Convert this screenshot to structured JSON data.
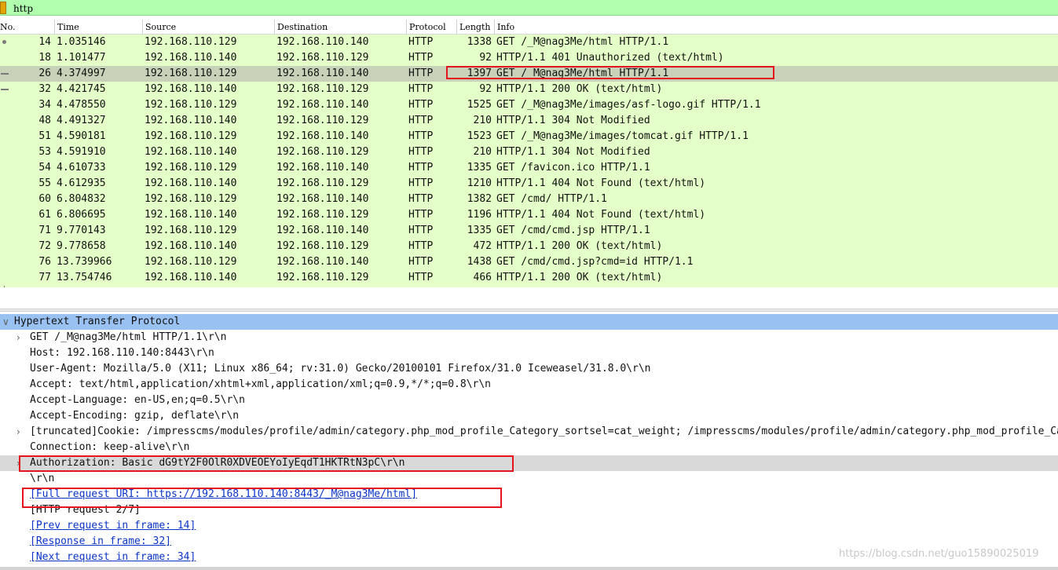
{
  "filter": {
    "text": "http",
    "bg_color": "#afffaf"
  },
  "columns": [
    "No.",
    "Time",
    "Source",
    "Destination",
    "Protocol",
    "Length",
    "Info"
  ],
  "packets": [
    {
      "no": "14",
      "time": "1.035146",
      "src": "192.168.110.129",
      "dst": "192.168.110.140",
      "proto": "HTTP",
      "len": "1338",
      "info": "GET /_M@nag3Me/html HTTP/1.1"
    },
    {
      "no": "18",
      "time": "1.101477",
      "src": "192.168.110.140",
      "dst": "192.168.110.129",
      "proto": "HTTP",
      "len": "92",
      "info": "HTTP/1.1 401 Unauthorized  (text/html)"
    },
    {
      "no": "26",
      "time": "4.374997",
      "src": "192.168.110.129",
      "dst": "192.168.110.140",
      "proto": "HTTP",
      "len": "1397",
      "info": "GET /_M@nag3Me/html HTTP/1.1",
      "selected": true
    },
    {
      "no": "32",
      "time": "4.421745",
      "src": "192.168.110.140",
      "dst": "192.168.110.129",
      "proto": "HTTP",
      "len": "92",
      "info": "HTTP/1.1 200 OK  (text/html)"
    },
    {
      "no": "34",
      "time": "4.478550",
      "src": "192.168.110.129",
      "dst": "192.168.110.140",
      "proto": "HTTP",
      "len": "1525",
      "info": "GET /_M@nag3Me/images/asf-logo.gif HTTP/1.1"
    },
    {
      "no": "48",
      "time": "4.491327",
      "src": "192.168.110.140",
      "dst": "192.168.110.129",
      "proto": "HTTP",
      "len": "210",
      "info": "HTTP/1.1 304 Not Modified"
    },
    {
      "no": "51",
      "time": "4.590181",
      "src": "192.168.110.129",
      "dst": "192.168.110.140",
      "proto": "HTTP",
      "len": "1523",
      "info": "GET /_M@nag3Me/images/tomcat.gif HTTP/1.1"
    },
    {
      "no": "53",
      "time": "4.591910",
      "src": "192.168.110.140",
      "dst": "192.168.110.129",
      "proto": "HTTP",
      "len": "210",
      "info": "HTTP/1.1 304 Not Modified"
    },
    {
      "no": "54",
      "time": "4.610733",
      "src": "192.168.110.129",
      "dst": "192.168.110.140",
      "proto": "HTTP",
      "len": "1335",
      "info": "GET /favicon.ico HTTP/1.1"
    },
    {
      "no": "55",
      "time": "4.612935",
      "src": "192.168.110.140",
      "dst": "192.168.110.129",
      "proto": "HTTP",
      "len": "1210",
      "info": "HTTP/1.1 404 Not Found  (text/html)"
    },
    {
      "no": "60",
      "time": "6.804832",
      "src": "192.168.110.129",
      "dst": "192.168.110.140",
      "proto": "HTTP",
      "len": "1382",
      "info": "GET /cmd/ HTTP/1.1"
    },
    {
      "no": "61",
      "time": "6.806695",
      "src": "192.168.110.140",
      "dst": "192.168.110.129",
      "proto": "HTTP",
      "len": "1196",
      "info": "HTTP/1.1 404 Not Found  (text/html)"
    },
    {
      "no": "71",
      "time": "9.770143",
      "src": "192.168.110.129",
      "dst": "192.168.110.140",
      "proto": "HTTP",
      "len": "1335",
      "info": "GET /cmd/cmd.jsp HTTP/1.1"
    },
    {
      "no": "72",
      "time": "9.778658",
      "src": "192.168.110.140",
      "dst": "192.168.110.129",
      "proto": "HTTP",
      "len": "472",
      "info": "HTTP/1.1 200 OK  (text/html)"
    },
    {
      "no": "76",
      "time": "13.739966",
      "src": "192.168.110.129",
      "dst": "192.168.110.140",
      "proto": "HTTP",
      "len": "1438",
      "info": "GET /cmd/cmd.jsp?cmd=id HTTP/1.1"
    },
    {
      "no": "77",
      "time": "13.754746",
      "src": "192.168.110.140",
      "dst": "192.168.110.129",
      "proto": "HTTP",
      "len": "466",
      "info": "HTTP/1.1 200 OK  (text/html)"
    }
  ],
  "details": {
    "protocol": "Hypertext Transfer Protocol",
    "lines": [
      {
        "text": "GET /_M@nag3Me/html HTTP/1.1\\r\\n",
        "expandable": true
      },
      {
        "text": "Host: 192.168.110.140:8443\\r\\n"
      },
      {
        "text": "User-Agent: Mozilla/5.0 (X11; Linux x86_64; rv:31.0) Gecko/20100101 Firefox/31.0 Iceweasel/31.8.0\\r\\n"
      },
      {
        "text": "Accept: text/html,application/xhtml+xml,application/xml;q=0.9,*/*;q=0.8\\r\\n"
      },
      {
        "text": "Accept-Language: en-US,en;q=0.5\\r\\n"
      },
      {
        "text": "Accept-Encoding: gzip, deflate\\r\\n"
      },
      {
        "text": " [truncated]Cookie: /impresscms/modules/profile/admin/category.php_mod_profile_Category_sortsel=cat_weight; /impresscms/modules/profile/admin/category.php_mod_profile_Category_orde",
        "expandable": true
      },
      {
        "text": "Connection: keep-alive\\r\\n"
      },
      {
        "text": "Authorization: Basic dG9tY2F0OlR0XDVEOEYoIyEqdT1HKTRtN3pC\\r\\n",
        "expandable": true,
        "highlight": true
      },
      {
        "text": "\\r\\n"
      },
      {
        "text": "[Full request URI: https://192.168.110.140:8443/_M@nag3Me/html]",
        "link": true
      },
      {
        "text": "[HTTP request 2/7]"
      },
      {
        "text": "[Prev request in frame: 14]",
        "link": true
      },
      {
        "text": "[Response in frame: 32]",
        "link": true
      },
      {
        "text": "[Next request in frame: 34]",
        "link": true
      }
    ]
  },
  "watermark": "https://blog.csdn.net/guo15890025019"
}
